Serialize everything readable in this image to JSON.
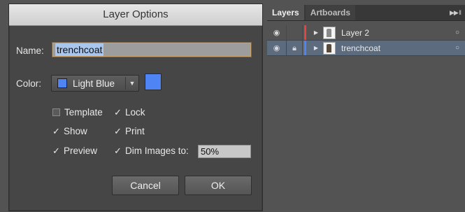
{
  "dialog": {
    "title": "Layer Options",
    "name_label": "Name:",
    "name_value": "trenchcoat",
    "color_label": "Color:",
    "color_value": "Light Blue",
    "color_hex": "#4f84f5",
    "checkboxes": {
      "template": {
        "label": "Template",
        "checked": false
      },
      "lock": {
        "label": "Lock",
        "checked": true
      },
      "show": {
        "label": "Show",
        "checked": true
      },
      "print": {
        "label": "Print",
        "checked": true
      },
      "preview": {
        "label": "Preview",
        "checked": true
      },
      "dim_images": {
        "label": "Dim Images to:",
        "checked": true
      }
    },
    "dim_value": "50%",
    "cancel_label": "Cancel",
    "ok_label": "OK"
  },
  "panel": {
    "tabs": [
      "Layers",
      "Artboards"
    ],
    "menu_icon": "panel-menu-icon",
    "layers": [
      {
        "name": "Layer 2",
        "color": "#e0463f",
        "visible": true,
        "locked": false,
        "selected": false
      },
      {
        "name": "trenchcoat",
        "color": "#4f84f5",
        "visible": true,
        "locked": true,
        "selected": true
      }
    ]
  }
}
